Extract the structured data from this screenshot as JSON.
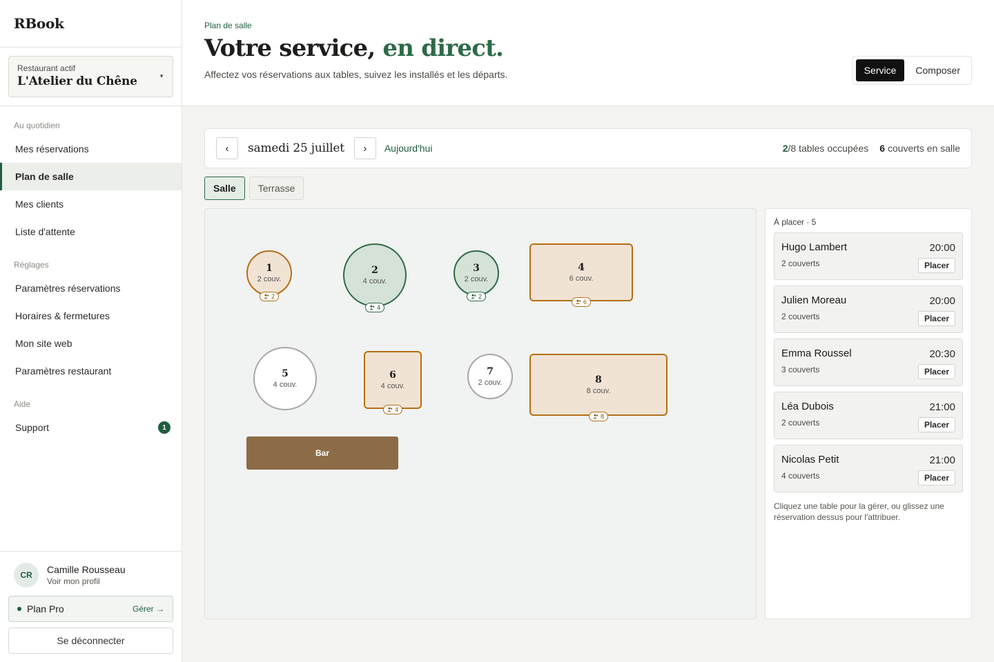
{
  "app": {
    "brand": "RBook"
  },
  "restaurant_selector": {
    "label": "Restaurant actif",
    "name": "L'Atelier du Chêne"
  },
  "sidebar": {
    "sections": [
      {
        "title": "Au quotidien",
        "items": [
          {
            "label": "Mes réservations"
          },
          {
            "label": "Plan de salle",
            "active": true
          },
          {
            "label": "Mes clients"
          },
          {
            "label": "Liste d'attente"
          }
        ]
      },
      {
        "title": "Réglages",
        "items": [
          {
            "label": "Paramètres réservations"
          },
          {
            "label": "Horaires & fermetures"
          },
          {
            "label": "Mon site web"
          },
          {
            "label": "Paramètres restaurant"
          }
        ]
      },
      {
        "title": "Aide",
        "items": [
          {
            "label": "Support",
            "badge": "1"
          }
        ]
      }
    ]
  },
  "user": {
    "initials": "CR",
    "name": "Camille Rousseau",
    "profile_link": "Voir mon profil"
  },
  "plan": {
    "label": "Plan Pro",
    "manage": "Gérer →"
  },
  "logout": "Se déconnecter",
  "header": {
    "eyebrow": "Plan de salle",
    "title_main": "Votre service,",
    "title_accent": "en direct.",
    "subtitle": "Affectez vos réservations aux tables, suivez les installés et les départs.",
    "modes": [
      "Service",
      "Composer"
    ],
    "active_mode": "Service"
  },
  "datebar": {
    "prev": "‹",
    "next": "›",
    "date": "samedi 25 juillet",
    "today": "Aujourd'hui",
    "occupied": "2",
    "occupied_suffix": "/8 tables occupées",
    "covers": "6",
    "covers_suffix": "couverts en salle"
  },
  "rooms": {
    "tabs": [
      "Salle",
      "Terrasse"
    ],
    "active": "Salle"
  },
  "floor": {
    "tables": [
      {
        "num": "1",
        "cap": "2 couv.",
        "status": "reserved",
        "guests": "2"
      },
      {
        "num": "2",
        "cap": "4 couv.",
        "status": "seated",
        "guests": "4"
      },
      {
        "num": "3",
        "cap": "2 couv.",
        "status": "seated",
        "guests": "2"
      },
      {
        "num": "4",
        "cap": "6 couv.",
        "status": "reserved",
        "guests": "6"
      },
      {
        "num": "5",
        "cap": "4 couv.",
        "status": "free"
      },
      {
        "num": "6",
        "cap": "4 couv.",
        "status": "reserved",
        "guests": "4"
      },
      {
        "num": "7",
        "cap": "2 couv.",
        "status": "free"
      },
      {
        "num": "8",
        "cap": "8 couv.",
        "status": "reserved",
        "guests": "8"
      }
    ],
    "bar_label": "Bar",
    "colors": {
      "reserved": "#b56e14",
      "seated": "#2d6a47",
      "free": "#a7a7a3",
      "bar": "#8c6c46"
    }
  },
  "panel": {
    "title": "À placer · 5",
    "place_label": "Placer",
    "reservations": [
      {
        "name": "Hugo Lambert",
        "time": "20:00",
        "covers": "2 couverts"
      },
      {
        "name": "Julien Moreau",
        "time": "20:00",
        "covers": "2 couverts"
      },
      {
        "name": "Emma Roussel",
        "time": "20:30",
        "covers": "3 couverts"
      },
      {
        "name": "Léa Dubois",
        "time": "21:00",
        "covers": "2 couverts"
      },
      {
        "name": "Nicolas Petit",
        "time": "21:00",
        "covers": "4 couverts"
      }
    ],
    "hint": "Cliquez une table pour la gérer, ou glissez une réservation dessus pour l'attribuer."
  }
}
